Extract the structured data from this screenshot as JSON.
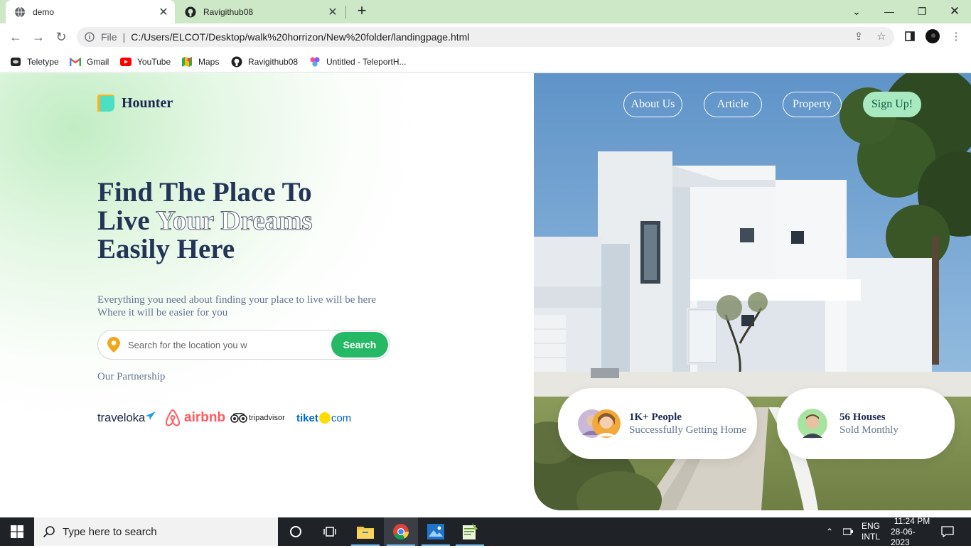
{
  "browser": {
    "tabs": [
      {
        "title": "demo",
        "active": true
      },
      {
        "title": "Ravigithub08",
        "active": false
      }
    ],
    "address": {
      "scheme": "File",
      "url": "C:/Users/ELCOT/Desktop/walk%20horrizon/New%20folder/landingpage.html"
    },
    "bookmarks": [
      "Teletype",
      "Gmail",
      "YouTube",
      "Maps",
      "Ravigithub08",
      "Untitled - TeleportH..."
    ]
  },
  "page": {
    "brand": "Hounter",
    "nav": [
      "About Us",
      "Article",
      "Property",
      "Sign Up!"
    ],
    "hero": {
      "line1": "Find The Place To",
      "line2_start": "Live ",
      "line2_outline": "Your Dreams",
      "line3": "Easily Here"
    },
    "subtitle_line1": "Everything you need about finding your place to live will be here",
    "subtitle_line2": "Where it will be easier for you",
    "search": {
      "placeholder": "Search for the location you w",
      "button": "Search"
    },
    "partnership_label": "Our Partnership",
    "partners": {
      "traveloka": "traveloka",
      "airbnb": "airbnb",
      "tripadvisor": "tripadvisor",
      "tiket_a": "tiket",
      "tiket_b": "com"
    },
    "stats": [
      {
        "big": "1K+ People",
        "small": "Successfully Getting Home"
      },
      {
        "big": "56 Houses",
        "small": "Sold Monthly"
      }
    ]
  },
  "taskbar": {
    "search_placeholder": "Type here to search",
    "lang1": "ENG",
    "lang2": "INTL",
    "time": "11:24 PM",
    "date": "28-06-2023"
  },
  "colors": {
    "brand_navy": "#233556",
    "accent_green": "#25b865",
    "tabstrip": "#cde8c6",
    "signup_pill": "#a9e9c2"
  }
}
